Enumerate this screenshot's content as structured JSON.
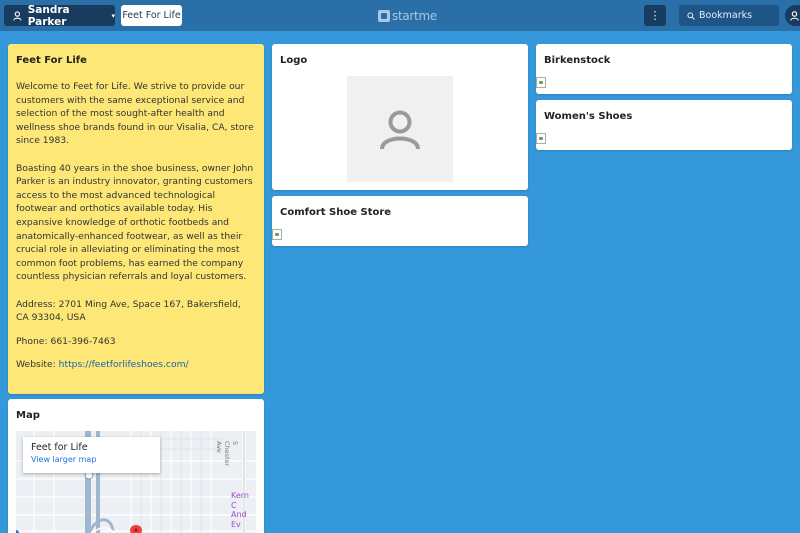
{
  "topbar": {
    "user_name": "Sandra Parker",
    "user_chevron": "▾",
    "page_tab": "Feet For Life",
    "brand": "startme",
    "menu_glyph": "⋮",
    "search_label": "Bookmarks"
  },
  "note": {
    "title": "Feet For Life",
    "paragraph1": "Welcome to Feet for Life. We strive to provide our customers with the same exceptional service and selection of the most sought-after health and wellness shoe brands found in our Visalia, CA, store since 1983.",
    "paragraph2": "Boasting 40 years in the shoe business, owner John Parker is an industry innovator, granting customers access to the most advanced technological footwear and orthotics available today. His expansive knowledge of orthotic footbeds and anatomically-enhanced footwear, as well as their crucial role in alleviating or eliminating the most common foot problems, has earned the company countless physician referrals and loyal customers.",
    "address": "Address: 2701 Ming Ave, Space 167, Bakersfield, CA 93304, USA",
    "phone": "Phone: 661-396-7463",
    "website_prefix": "Website: ",
    "website_link": "https://feetforlifeshoes.com/"
  },
  "map": {
    "title": "Map",
    "place_name": "Feet for Life",
    "larger_map_link": "View larger map",
    "poi_label_line1": "Kern C",
    "poi_label_line2": "And Ev",
    "street_label": "S Chester Ave"
  },
  "logo": {
    "title": "Logo"
  },
  "comfort": {
    "title": "Comfort Shoe Store"
  },
  "birkenstock": {
    "title": "Birkenstock"
  },
  "womens": {
    "title": "Women's Shoes"
  },
  "colors": {
    "background": "#3498db",
    "topbar": "#2a6fa8",
    "button_dark": "#173c60",
    "note_yellow": "#fde877",
    "link": "#1a5fb4"
  }
}
